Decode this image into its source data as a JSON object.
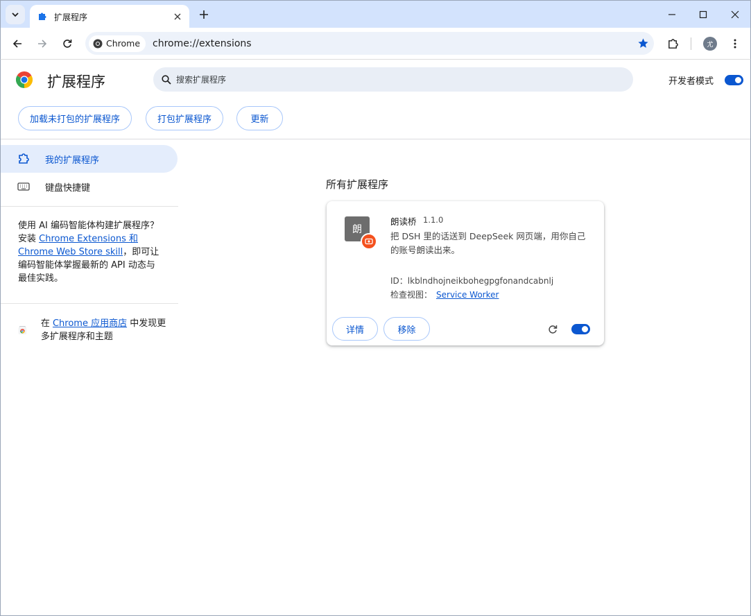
{
  "browser": {
    "tab_title": "扩展程序",
    "chip_label": "Chrome",
    "url": "chrome://extensions",
    "profile_initial": "尤"
  },
  "header": {
    "title": "扩展程序",
    "search_placeholder": "搜索扩展程序",
    "dev_mode_label": "开发者模式",
    "dev_mode_on": true
  },
  "actions": {
    "load_unpacked": "加载未打包的扩展程序",
    "pack": "打包扩展程序",
    "update": "更新"
  },
  "sidebar": {
    "items": [
      {
        "label": "我的扩展程序",
        "active": true,
        "icon": "extension-icon"
      },
      {
        "label": "键盘快捷键",
        "active": false,
        "icon": "keyboard-icon"
      }
    ],
    "ai_text_prefix": "使用 AI 编码智能体构建扩展程序？安装 ",
    "ai_link": "Chrome Extensions 和 Chrome Web Store skill",
    "ai_text_suffix": "，即可让编码智能体掌握最新的 API 动态与最佳实践。",
    "store_prefix": "在 ",
    "store_link": "Chrome 应用商店",
    "store_suffix": " 中发现更多扩展程序和主题"
  },
  "main": {
    "section_title": "所有扩展程序",
    "extensions": [
      {
        "icon_char": "朗",
        "name": "朗读桥",
        "version": "1.1.0",
        "description": "把 DSH 里的话送到 DeepSeek 网页端，用你自己的账号朗读出来。",
        "id_label": "ID：",
        "id": "lkblndhojneikbohegpgfonandcabnlj",
        "inspect_label": "检查视图：",
        "inspect_link": "Service Worker",
        "details_label": "详情",
        "remove_label": "移除",
        "enabled": true
      }
    ]
  },
  "colors": {
    "accent": "#0b57d0",
    "tabstrip": "#d3e3fd",
    "badge": "#f4511e"
  }
}
